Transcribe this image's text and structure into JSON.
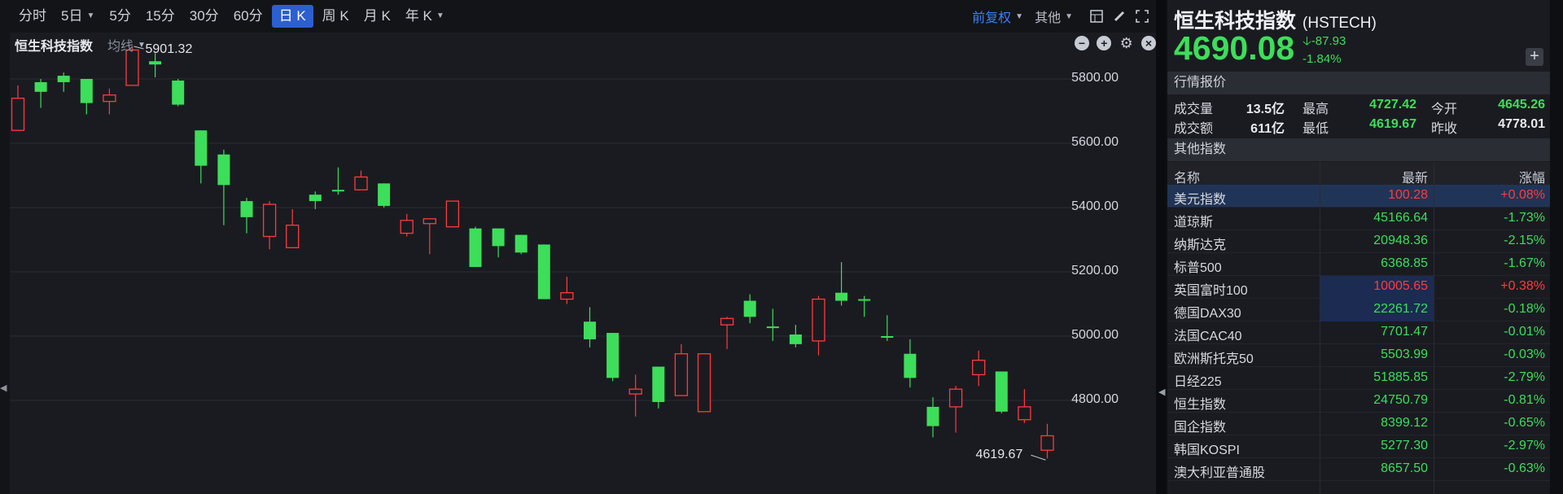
{
  "toolbar": {
    "timeframes": [
      {
        "label": "分时",
        "active": false,
        "dropdown": false
      },
      {
        "label": "5日",
        "active": false,
        "dropdown": true
      },
      {
        "label": "5分",
        "active": false,
        "dropdown": false
      },
      {
        "label": "15分",
        "active": false,
        "dropdown": false
      },
      {
        "label": "30分",
        "active": false,
        "dropdown": false
      },
      {
        "label": "60分",
        "active": false,
        "dropdown": false
      },
      {
        "label": "日 K",
        "active": true,
        "dropdown": false
      },
      {
        "label": "周 K",
        "active": false,
        "dropdown": false
      },
      {
        "label": "月 K",
        "active": false,
        "dropdown": false
      },
      {
        "label": "年 K",
        "active": false,
        "dropdown": true
      }
    ],
    "adjust": "前复权",
    "other": "其他"
  },
  "chart": {
    "instrument": "恒生科技指数",
    "indicator": "均线",
    "y_ticks": [
      "5800.00",
      "5600.00",
      "5400.00",
      "5200.00",
      "5000.00",
      "4800.00"
    ],
    "high_label": "5901.32",
    "low_label": "4619.67"
  },
  "chart_data": {
    "type": "candlestick",
    "ylim": [
      4615,
      5910
    ],
    "y_ticks": [
      5800,
      5600,
      5400,
      5200,
      5000,
      4800
    ],
    "up_color": "#ff3b3b",
    "down_color": "#3dde5a",
    "candles": [
      {
        "o": 5640,
        "c": 5740,
        "h": 5780,
        "l": 5640
      },
      {
        "o": 5790,
        "c": 5760,
        "h": 5800,
        "l": 5710
      },
      {
        "o": 5810,
        "c": 5790,
        "h": 5820,
        "l": 5760
      },
      {
        "o": 5800,
        "c": 5725,
        "h": 5800,
        "l": 5690
      },
      {
        "o": 5730,
        "c": 5750,
        "h": 5770,
        "l": 5690
      },
      {
        "o": 5780,
        "c": 5890,
        "h": 5901.32,
        "l": 5780
      },
      {
        "o": 5855,
        "c": 5845,
        "h": 5880,
        "l": 5805
      },
      {
        "o": 5795,
        "c": 5720,
        "h": 5800,
        "l": 5715
      },
      {
        "o": 5640,
        "c": 5530,
        "h": 5640,
        "l": 5475
      },
      {
        "o": 5565,
        "c": 5470,
        "h": 5580,
        "l": 5345
      },
      {
        "o": 5420,
        "c": 5370,
        "h": 5430,
        "l": 5320
      },
      {
        "o": 5310,
        "c": 5410,
        "h": 5420,
        "l": 5270
      },
      {
        "o": 5275,
        "c": 5345,
        "h": 5395,
        "l": 5275
      },
      {
        "o": 5440,
        "c": 5420,
        "h": 5450,
        "l": 5395
      },
      {
        "o": 5455,
        "c": 5450,
        "h": 5525,
        "l": 5440
      },
      {
        "o": 5455,
        "c": 5495,
        "h": 5515,
        "l": 5455
      },
      {
        "o": 5475,
        "c": 5405,
        "h": 5475,
        "l": 5400
      },
      {
        "o": 5320,
        "c": 5360,
        "h": 5380,
        "l": 5310
      },
      {
        "o": 5350,
        "c": 5365,
        "h": 5365,
        "l": 5255
      },
      {
        "o": 5340,
        "c": 5420,
        "h": 5420,
        "l": 5340
      },
      {
        "o": 5335,
        "c": 5215,
        "h": 5340,
        "l": 5215
      },
      {
        "o": 5335,
        "c": 5280,
        "h": 5335,
        "l": 5245
      },
      {
        "o": 5315,
        "c": 5260,
        "h": 5315,
        "l": 5255
      },
      {
        "o": 5285,
        "c": 5115,
        "h": 5285,
        "l": 5115
      },
      {
        "o": 5115,
        "c": 5135,
        "h": 5185,
        "l": 5100
      },
      {
        "o": 5045,
        "c": 4990,
        "h": 5090,
        "l": 4965
      },
      {
        "o": 5010,
        "c": 4870,
        "h": 5010,
        "l": 4860
      },
      {
        "o": 4820,
        "c": 4835,
        "h": 4880,
        "l": 4750
      },
      {
        "o": 4905,
        "c": 4795,
        "h": 4905,
        "l": 4775
      },
      {
        "o": 4815,
        "c": 4945,
        "h": 4975,
        "l": 4815
      },
      {
        "o": 4765,
        "c": 4945,
        "h": 4945,
        "l": 4765
      },
      {
        "o": 5035,
        "c": 5055,
        "h": 5060,
        "l": 4960
      },
      {
        "o": 5110,
        "c": 5060,
        "h": 5130,
        "l": 5040
      },
      {
        "o": 5030,
        "c": 5025,
        "h": 5085,
        "l": 4985
      },
      {
        "o": 5005,
        "c": 4975,
        "h": 5035,
        "l": 4965
      },
      {
        "o": 4985,
        "c": 5115,
        "h": 5125,
        "l": 4940
      },
      {
        "o": 5135,
        "c": 5110,
        "h": 5230,
        "l": 5095
      },
      {
        "o": 5115,
        "c": 5110,
        "h": 5125,
        "l": 5060
      },
      {
        "o": 5000,
        "c": 4995,
        "h": 5065,
        "l": 4985
      },
      {
        "o": 4945,
        "c": 4870,
        "h": 4990,
        "l": 4840
      },
      {
        "o": 4780,
        "c": 4720,
        "h": 4810,
        "l": 4685
      },
      {
        "o": 4780,
        "c": 4835,
        "h": 4845,
        "l": 4700
      },
      {
        "o": 4880,
        "c": 4925,
        "h": 4955,
        "l": 4845
      },
      {
        "o": 4890,
        "c": 4765,
        "h": 4890,
        "l": 4760
      },
      {
        "o": 4740,
        "c": 4780,
        "h": 4835,
        "l": 4730
      },
      {
        "o": 4645,
        "c": 4690,
        "h": 4727,
        "l": 4619.67
      }
    ]
  },
  "panel": {
    "title": "恒生科技指数",
    "code": "(HSTECH)",
    "price": "4690.08",
    "change": "-87.93",
    "change_pct": "-1.84%",
    "plus": "+",
    "section_quote": "行情报价",
    "quote": {
      "vol_label": "成交量",
      "vol": "13.5亿",
      "high_label": "最高",
      "high": "4727.42",
      "open_label": "今开",
      "open": "4645.26",
      "amt_label": "成交额",
      "amt": "611亿",
      "low_label": "最低",
      "low": "4619.67",
      "prev_label": "昨收",
      "prev": "4778.01"
    },
    "section_other": "其他指数",
    "table_head": {
      "name": "名称",
      "last": "最新",
      "pct": "涨幅"
    },
    "rows": [
      {
        "name": "美元指数",
        "last": "100.28",
        "pct": "+0.08%",
        "dir": "up",
        "selected": true,
        "highlight": false
      },
      {
        "name": "道琼斯",
        "last": "45166.64",
        "pct": "-1.73%",
        "dir": "dn",
        "selected": false,
        "highlight": false
      },
      {
        "name": "纳斯达克",
        "last": "20948.36",
        "pct": "-2.15%",
        "dir": "dn",
        "selected": false,
        "highlight": false
      },
      {
        "name": "标普500",
        "last": "6368.85",
        "pct": "-1.67%",
        "dir": "dn",
        "selected": false,
        "highlight": false
      },
      {
        "name": "英国富时100",
        "last": "10005.65",
        "pct": "+0.38%",
        "dir": "up",
        "selected": false,
        "highlight": true
      },
      {
        "name": "德国DAX30",
        "last": "22261.72",
        "pct": "-0.18%",
        "dir": "dn",
        "selected": false,
        "highlight": true
      },
      {
        "name": "法国CAC40",
        "last": "7701.47",
        "pct": "-0.01%",
        "dir": "dn",
        "selected": false,
        "highlight": false
      },
      {
        "name": "欧洲斯托克50",
        "last": "5503.99",
        "pct": "-0.03%",
        "dir": "dn",
        "selected": false,
        "highlight": false
      },
      {
        "name": "日经225",
        "last": "51885.85",
        "pct": "-2.79%",
        "dir": "dn",
        "selected": false,
        "highlight": false
      },
      {
        "name": "恒生指数",
        "last": "24750.79",
        "pct": "-0.81%",
        "dir": "dn",
        "selected": false,
        "highlight": false
      },
      {
        "name": "国企指数",
        "last": "8399.12",
        "pct": "-0.65%",
        "dir": "dn",
        "selected": false,
        "highlight": false
      },
      {
        "name": "韩国KOSPI",
        "last": "5277.30",
        "pct": "-2.97%",
        "dir": "dn",
        "selected": false,
        "highlight": false
      },
      {
        "name": "澳大利亚普通股",
        "last": "8657.50",
        "pct": "-0.63%",
        "dir": "dn",
        "selected": false,
        "highlight": false
      }
    ]
  }
}
